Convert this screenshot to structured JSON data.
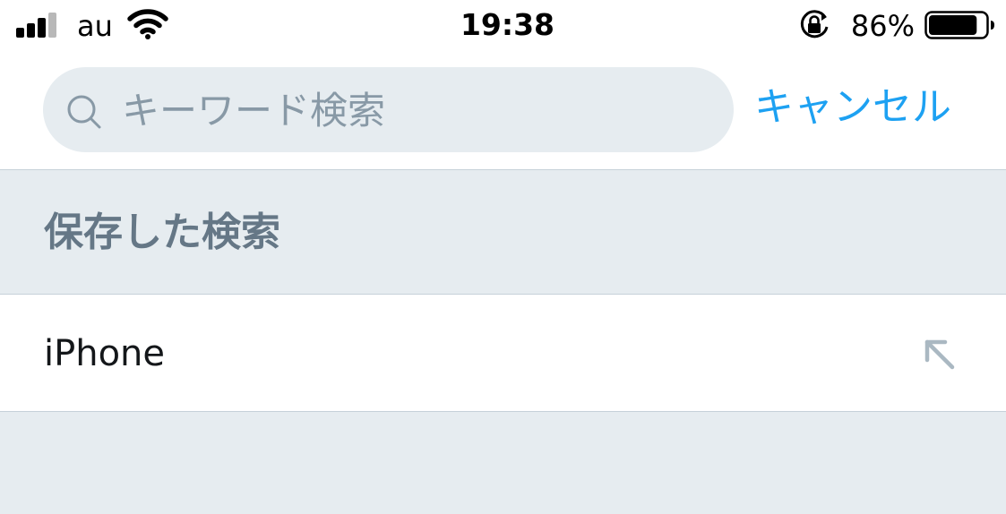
{
  "status_bar": {
    "carrier": "au",
    "time": "19:38",
    "battery_percent": "86%",
    "battery_level": 0.86,
    "signal_bars_active": 3,
    "icons": [
      "signal-icon",
      "wifi-icon",
      "rotation-lock-icon",
      "battery-icon"
    ]
  },
  "search": {
    "placeholder": "キーワード検索",
    "value": "",
    "cancel_label": "キャンセル"
  },
  "saved_searches": {
    "title": "保存した検索",
    "items": [
      {
        "label": "iPhone",
        "icon": "arrow-up-left-icon"
      }
    ]
  },
  "colors": {
    "accent": "#1da1f2",
    "placeholder": "#8899a6",
    "section_title": "#657786",
    "background": "#e6ecf0",
    "text": "#14171a",
    "divider": "#c6d1d9"
  }
}
